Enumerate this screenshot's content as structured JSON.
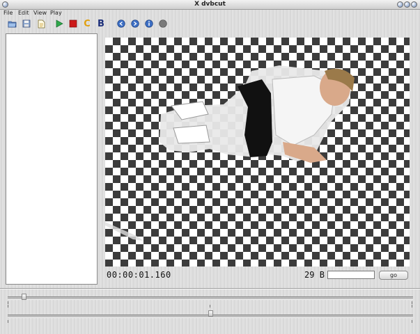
{
  "window": {
    "title": "dvbcut",
    "title_logo": "X"
  },
  "menubar": {
    "items": [
      {
        "label": "File"
      },
      {
        "label": "Edit"
      },
      {
        "label": "View"
      },
      {
        "label": "Play"
      }
    ]
  },
  "toolbar": {
    "buttons": [
      {
        "icon": "open-folder-icon"
      },
      {
        "icon": "save-disk-icon"
      },
      {
        "icon": "export-document-icon"
      },
      {
        "icon": "play-icon"
      },
      {
        "icon": "stop-icon"
      },
      {
        "icon": "cut-marker-c-icon",
        "glyph": "C"
      },
      {
        "icon": "bookmark-b-icon",
        "glyph": "B"
      },
      {
        "icon": "jump-back-icon"
      },
      {
        "icon": "jump-forward-icon"
      },
      {
        "icon": "info-icon"
      },
      {
        "icon": "record-dot-icon"
      }
    ]
  },
  "status": {
    "timecode": "00:00:01.160",
    "frame_count": "29",
    "frame_type": "B",
    "goto_value": "",
    "go_label": "go"
  },
  "colors": {
    "play": "#2ea84a",
    "stop": "#cc1a1a",
    "cut_marker": "#e0a010",
    "bookmark": "#1c2f7a",
    "nav_blue": "#3d6fc4"
  },
  "sliders": {
    "coarse_position": 0.04,
    "fine_position": 0.5
  }
}
